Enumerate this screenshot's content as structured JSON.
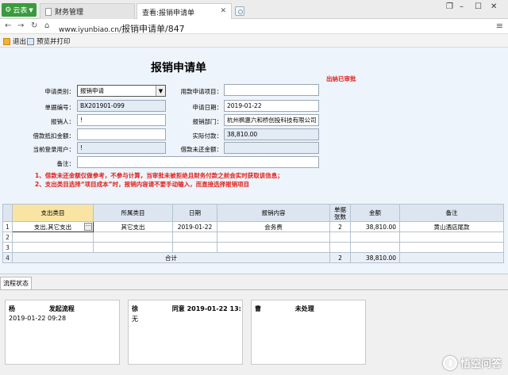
{
  "browser": {
    "app_label": "云表",
    "tabs": [
      {
        "label": "财务管理"
      },
      {
        "label": "查看:报销申请单"
      }
    ],
    "url_host": "www.iyunbiao.cn/",
    "url_path": "报销申请单/847"
  },
  "toolbar": {
    "exit_label": "退出",
    "print_label": "预览并打印"
  },
  "form": {
    "title": "报销申请单",
    "status": "出纳已审批",
    "fields": {
      "apply_type_label": "申请类别：",
      "apply_type_value": "报销申请",
      "project_label": "用款申请项目：",
      "project_value": "",
      "doc_no_label": "单据编号：",
      "doc_no_value": "BX201901-099",
      "apply_date_label": "申请日期：",
      "apply_date_value": "2019-01-22",
      "applicant_label": "报销人：",
      "applicant_value": "!",
      "dept_label": "报销部门：",
      "dept_value": "杭州枫惠六和桥创投科技有限公司",
      "loan_offset_label": "借款抵扣金额：",
      "loan_offset_value": "",
      "actual_pay_label": "实际付款：",
      "actual_pay_value": "38,810.00",
      "current_user_label": "当前登录用户：",
      "current_user_value": "!",
      "unreturned_loan_label": "借款未还金额：",
      "unreturned_loan_value": "",
      "remark_label": "备注：",
      "remark_value": ""
    },
    "notes": [
      "1、借款未还金额仅做参考，不参与计算，当审批未被拒绝且财务付款之前会实时获取该信息；",
      "2、支出类目选择“项目成本”时，报销内容请不要手动输入，而直接选择报销项目"
    ]
  },
  "grid": {
    "headers": [
      "支出类目",
      "所属类目",
      "日期",
      "报销内容",
      "单据\n张数",
      "金额",
      "备注"
    ],
    "rows": [
      {
        "num": "1",
        "category": "支出,其它支出",
        "parent": "其它支出",
        "date": "2019-01-22",
        "content": "会务费",
        "count": "2",
        "amount": "38,810.00",
        "remark": "黄山酒店尾款"
      },
      {
        "num": "2",
        "category": "",
        "parent": "",
        "date": "",
        "content": "",
        "count": "",
        "amount": "",
        "remark": ""
      },
      {
        "num": "3",
        "category": "",
        "parent": "",
        "date": "",
        "content": "",
        "count": "",
        "amount": "",
        "remark": ""
      }
    ],
    "total": {
      "num": "4",
      "label": "合计",
      "count": "2",
      "amount": "38,810.00"
    }
  },
  "workflow": {
    "tab_label": "流程状态",
    "cards": [
      {
        "name": "杨",
        "action": "发起流程",
        "detail": "2019-01-22 09:28"
      },
      {
        "name": "徐",
        "action": "同意 2019-01-22 13:",
        "detail": "无"
      },
      {
        "name": "曹",
        "action": "未处理",
        "detail": ""
      }
    ]
  },
  "watermark": "悟空问答"
}
